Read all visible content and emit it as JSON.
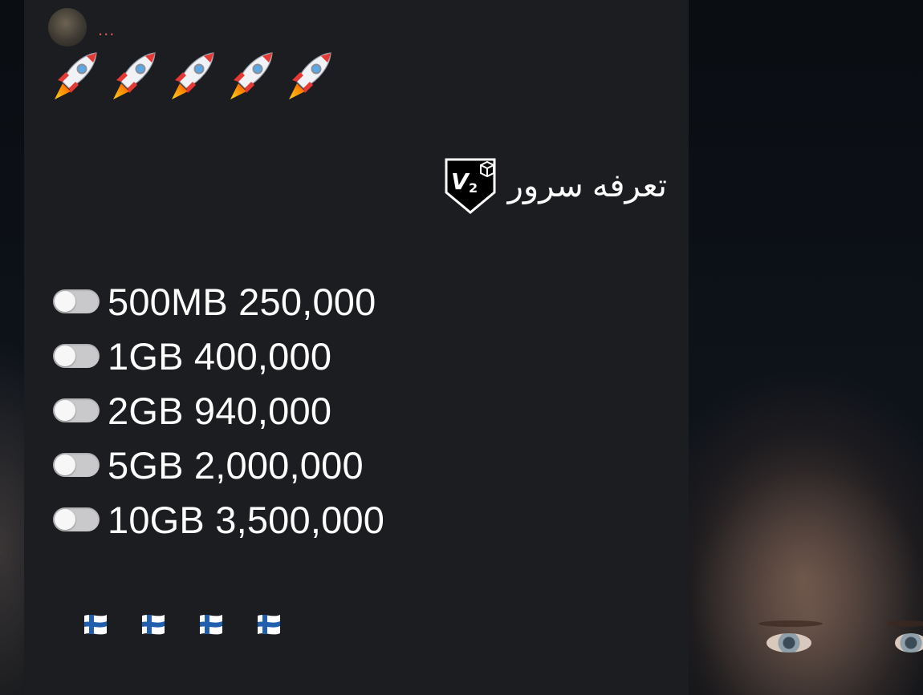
{
  "message": {
    "sender_indicator": "...",
    "rocket_icons": [
      "rocket-icon",
      "rocket-icon",
      "rocket-icon",
      "rocket-icon",
      "rocket-icon"
    ],
    "title": "تعرفه سرور",
    "title_badge_icon": "v2-shield-icon",
    "plans": [
      {
        "text": "500MB 250,000",
        "toggle_icon": "toggle-off-icon"
      },
      {
        "text": "1GB 400,000",
        "toggle_icon": "toggle-off-icon"
      },
      {
        "text": "2GB 940,000",
        "toggle_icon": "toggle-off-icon"
      },
      {
        "text": "5GB 2,000,000",
        "toggle_icon": "toggle-off-icon"
      },
      {
        "text": "10GB 3,500,000",
        "toggle_icon": "toggle-off-icon"
      }
    ],
    "flag_icons": [
      "finland-flag-icon",
      "finland-flag-icon",
      "finland-flag-icon",
      "finland-flag-icon"
    ]
  },
  "colors": {
    "card_background": "#1c1d20",
    "text": "#ffffff",
    "sender_indicator": "#d0584e",
    "toggle": "#c9c9cc"
  }
}
